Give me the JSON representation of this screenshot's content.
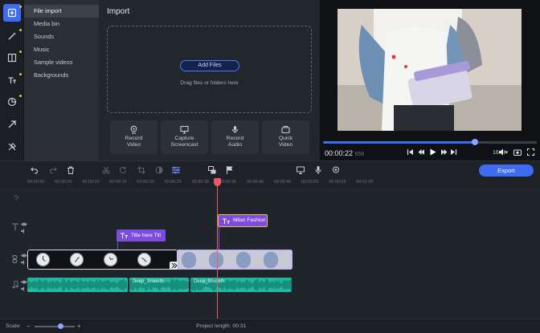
{
  "sidebar": {
    "tools": [
      {
        "icon": "import-icon",
        "active": true
      },
      {
        "icon": "magic-wand-icon"
      },
      {
        "icon": "transitions-icon"
      },
      {
        "icon": "titles-icon"
      },
      {
        "icon": "stickers-icon"
      },
      {
        "icon": "arrow-icon"
      },
      {
        "icon": "tools-icon"
      }
    ]
  },
  "import_menu": {
    "items": [
      "File import",
      "Media bin",
      "Sounds",
      "Music",
      "Sample videos",
      "Backgrounds"
    ]
  },
  "import_panel": {
    "title": "Import",
    "add_files": "Add Files",
    "drop_hint": "Drag files or folders here",
    "actions": [
      {
        "line1": "Record",
        "line2": "Video",
        "icon": "webcam-icon"
      },
      {
        "line1": "Capture",
        "line2": "Screencast",
        "icon": "monitor-icon"
      },
      {
        "line1": "Record",
        "line2": "Audio",
        "icon": "microphone-icon"
      },
      {
        "line1": "Quick",
        "line2": "Video",
        "icon": "quick-video-icon"
      }
    ]
  },
  "preview": {
    "timecode": "00:00:22",
    "timecode_frames": "656",
    "progress": 0.71,
    "aspect_ratio": "16:9"
  },
  "timeline": {
    "export_label": "Export",
    "ruler_ticks": [
      "00:00:00",
      "00:00:05",
      "00:00:10",
      "00:00:15",
      "00:00:20",
      "00:00:25",
      "00:00:30",
      "00:00:35",
      "00:00:40",
      "00:00:45",
      "00:00:50",
      "00:00:55",
      "00:01:00"
    ],
    "title_clip_1": "Title here Titl",
    "title_clip_2": "Milan Fashion",
    "audio_clips": [
      "",
      "Deep_Smooth",
      "Deep_Smooth"
    ]
  },
  "status": {
    "scale_label": "Scale:",
    "project_length_label": "Project length:",
    "project_length": "00:31"
  },
  "colors": {
    "accent": "#3d6cf0",
    "title_clip": "#7c4ddc",
    "audio_clip": "#22b8a0",
    "playhead": "#e85a6a",
    "selection": "#e9c33a"
  }
}
